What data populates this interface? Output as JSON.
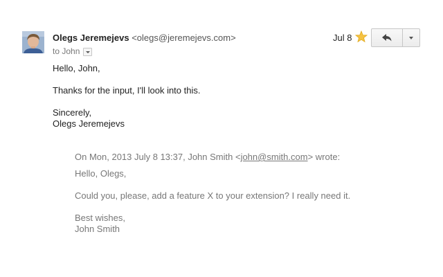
{
  "message": {
    "sender_name": "Olegs Jeremejevs",
    "sender_email": "<olegs@jeremejevs.com>",
    "to_label": "to John",
    "date": "Jul 8",
    "starred": true,
    "body": {
      "greeting": "Hello, John,",
      "line1": "Thanks for the input, I'll look into this.",
      "signoff": "Sincerely,",
      "signature": "Olegs Jeremejevs"
    },
    "quote": {
      "attribution_prefix": "On Mon, 2013 July 8 13:37, John Smith <",
      "attribution_email": "john@smith.com",
      "attribution_suffix": "> wrote:",
      "greeting": "Hello, Olegs,",
      "line1": "Could you, please, add a feature X to your extension? I really need it.",
      "signoff": "Best wishes,",
      "signature": "John Smith"
    }
  },
  "icons": {
    "star": "star-icon",
    "reply": "reply-icon",
    "more": "chevron-down-icon",
    "details": "chevron-down-icon"
  },
  "colors": {
    "star": "#f5c242",
    "quote_text": "#777777",
    "body_text": "#222222"
  }
}
